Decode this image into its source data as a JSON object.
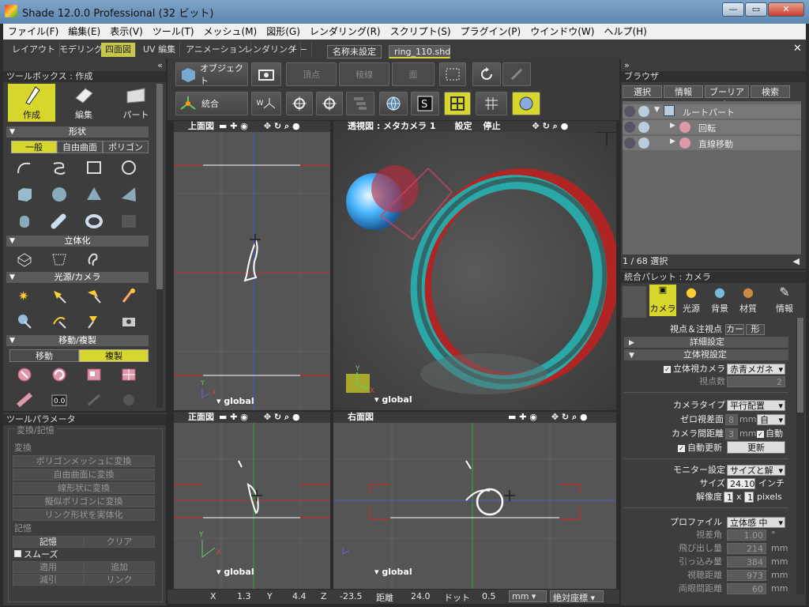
{
  "window": {
    "title": "Shade 12.0.0 Professional (32 ビット)",
    "min": "—",
    "max": "▭",
    "close": "✕"
  },
  "menu": [
    "ファイル(F)",
    "編集(E)",
    "表示(V)",
    "ツール(T)",
    "メッシュ(M)",
    "図形(G)",
    "レンダリング(R)",
    "スクリプト(S)",
    "プラグイン(P)",
    "ウインドウ(W)",
    "ヘルプ(H)"
  ],
  "workspace_tabs": [
    "レイアウト",
    "モデリング",
    "四面図",
    "UV 編集",
    "アニメーション",
    "レンダリング",
    "+ −"
  ],
  "doc_tabs": [
    "名称未設定",
    "ring_110.shd"
  ],
  "toolbox": {
    "header": "ツールボックス : 作成",
    "modes": [
      "作成",
      "編集",
      "パート"
    ],
    "sec_shape": "形状",
    "shape_tabs": [
      "一般",
      "自由曲面",
      "ポリゴン"
    ],
    "sec_solid": "立体化",
    "sec_light": "光源/カメラ",
    "sec_move": "移動/複製",
    "move_tabs": [
      "移動",
      "複製"
    ],
    "numeric": "0.0"
  },
  "toolparams": {
    "header": "ツールパラメータ",
    "group": "変換/記憶",
    "convert_label": "変換",
    "convert_buttons": [
      "ポリゴンメッシュに変換",
      "自由曲面に変換",
      "線形状に変換",
      "擬似ポリゴンに変換",
      "リンク形状を実体化"
    ],
    "memory_label": "記憶",
    "memory_buttons": [
      "記憶",
      "クリア"
    ],
    "smooth": "スムーズ",
    "apply_buttons": [
      "適用",
      "追加",
      "減引",
      "リンク"
    ]
  },
  "toolbar": {
    "object": "オブジェクト",
    "vertex": "頂点",
    "edge": "稜線",
    "face": "面",
    "integrate": "統合",
    "wlabel": "W"
  },
  "viewports": {
    "top": "上面図",
    "persp": "透視図 : メタカメラ 1",
    "persp_settings": "設定",
    "persp_stop": "停止",
    "front": "正面図",
    "right": "右面図",
    "global": "global"
  },
  "statusbar": {
    "x_label": "X",
    "x": "1.3",
    "y_label": "Y",
    "y": "4.4",
    "z_label": "Z",
    "z": "-23.5",
    "dist_label": "距離",
    "dist": "24.0",
    "dot_label": "ドット",
    "dot": "0.5",
    "unit": "mm",
    "coord": "絶対座標"
  },
  "browser": {
    "header": "ブラウザ",
    "tabs": [
      "選択",
      "情報",
      "ブーリアン",
      "検索"
    ],
    "tree": [
      "ルートパート",
      "回転",
      "直線移動"
    ],
    "status": "1 / 68 選択"
  },
  "palette": {
    "header": "統合パレット : カメラ",
    "tabs": [
      "カメラ",
      "光源",
      "背景",
      "材質",
      "情報"
    ],
    "viewpoint_label": "視点＆注視点",
    "viewpoint_buttons": [
      "カー",
      "形"
    ],
    "detail": "詳細設定",
    "stereo": "立体視設定",
    "stereo_camera": "立体視カメラ",
    "stereo_camera_value": "赤青メガネ",
    "viewpoints": "視点数",
    "viewpoints_value": "2",
    "camera_type": "カメラタイプ",
    "camera_type_value": "平行配置",
    "zero_parallax": "ゼロ視差面",
    "zero_value": "8",
    "zero_unit": "mm",
    "zero_mode": "自",
    "camera_gap": "カメラ間距離",
    "gap_value": "3",
    "gap_unit": "mm",
    "auto": "自動",
    "auto_update": "自動更新",
    "update": "更新",
    "monitor": "モニター設定",
    "monitor_value": "サイズと解",
    "size": "サイズ",
    "size_value": "24.10",
    "size_unit": "インチ",
    "resolution": "解像度",
    "res_a": "1",
    "res_x": "x",
    "res_b": "1",
    "res_unit": "pixels",
    "profile": "プロファイル",
    "profile_value": "立体感 中",
    "view_angle": "視差角",
    "view_angle_value": "1.00",
    "view_angle_unit": "°",
    "pop_out": "飛び出し量",
    "pop_out_value": "214",
    "pull_in": "引っ込み量",
    "pull_in_value": "384",
    "view_dist": "視聴距離",
    "view_dist_value": "973",
    "eye_dist": "両眼間距離",
    "eye_dist_value": "60",
    "mm": "mm"
  }
}
